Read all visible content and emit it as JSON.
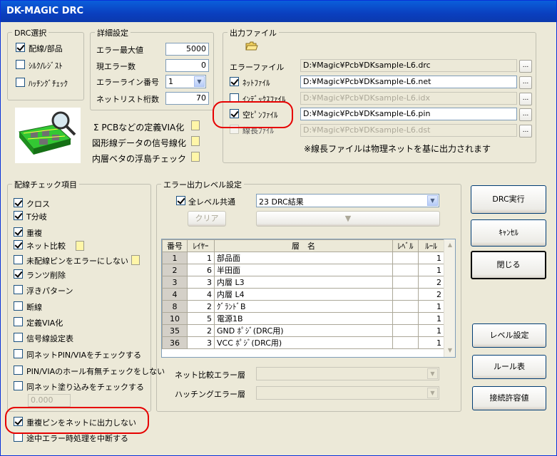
{
  "window": {
    "title": "DK-MAGIC DRC"
  },
  "drc_select": {
    "legend": "DRC選択",
    "items": [
      {
        "label": "配線/部品",
        "checked": true
      },
      {
        "label": "ｼﾙｸ/ﾚｼﾞｽﾄ",
        "checked": false
      },
      {
        "label": "ﾊｯﾁﾝｸﾞﾁｪｯｸ",
        "checked": false
      }
    ]
  },
  "detail": {
    "legend": "詳細設定",
    "max_error_label": "エラー最大値",
    "max_error_value": "5000",
    "current_error_label": "現エラー数",
    "current_error_value": "0",
    "error_line_label": "エラーライン番号",
    "error_line_value": "1",
    "netlist_digits_label": "ネットリスト桁数",
    "netlist_digits_value": "70"
  },
  "output_files": {
    "legend": "出力ファイル",
    "error_file_label": "エラーファイル",
    "error_file_value": "D:¥Magic¥Pcb¥DKsample-L6.drc",
    "net_file_label": "ﾈｯﾄﾌｧｲﾙ",
    "net_file_value": "D:¥Magic¥Pcb¥DKsample-L6.net",
    "index_file_label": "ｲﾝﾃﾞｯｸｽﾌｧｲﾙ",
    "index_file_value": "D:¥Magic¥Pcb¥DKsample-L6.idx",
    "empty_pin_label": "空ﾋﾟﾝﾌｧｲﾙ",
    "empty_pin_value": "D:¥Magic¥Pcb¥DKsample-L6.pin",
    "line_length_label": "線長ﾌｧｲﾙ",
    "line_length_value": "D:¥Magic¥Pcb¥DKsample-L6.dst",
    "note": "※線長ファイルは物理ネットを基に出力されます",
    "browse": "..."
  },
  "options": {
    "via_def": "Σ PCBなどの定義VIA化",
    "shape_signal": "図形線データの信号線化",
    "inner_island": "内層ベタの浮島チェック"
  },
  "wiring_check": {
    "legend": "配線チェック項目",
    "items": [
      {
        "label": "クロス",
        "checked": true
      },
      {
        "label": "T分岐",
        "checked": true
      },
      {
        "label": "重複",
        "checked": true
      },
      {
        "label": "ネット比較",
        "checked": true
      },
      {
        "label": "未配線ピンをエラーにしない",
        "checked": false
      },
      {
        "label": "ランツ削除",
        "checked": true
      },
      {
        "label": "浮きパターン",
        "checked": false
      },
      {
        "label": "断線",
        "checked": false
      },
      {
        "label": "定義VIA化",
        "checked": false
      },
      {
        "label": "信号線設定表",
        "checked": false
      },
      {
        "label": "同ネットPIN/VIAをチェックする",
        "checked": false
      },
      {
        "label": "PIN/VIAのホール有無チェックをしない",
        "checked": false
      },
      {
        "label": "同ネット塗り込みをチェックする",
        "checked": false
      }
    ],
    "fill_value": "0.000",
    "dup_pin": "重複ピンをネットに出力しない",
    "truncated": "途中エラー時処理を中断する"
  },
  "error_level": {
    "legend": "エラー出力レベル設定",
    "all_common_label": "全レベル共通",
    "level_select": "23  DRC結果",
    "clear_label": "クリア",
    "table_headers": [
      "番号",
      "ﾚｲﾔｰ",
      "層　名",
      "ﾚﾍﾞﾙ",
      "ﾙｰﾙ"
    ],
    "rows": [
      [
        "1",
        "1",
        "部品面",
        "",
        "1"
      ],
      [
        "2",
        "6",
        "半田面",
        "",
        "1"
      ],
      [
        "3",
        "3",
        "内層 L3",
        "",
        "2"
      ],
      [
        "4",
        "4",
        "内層 L4",
        "",
        "2"
      ],
      [
        "8",
        "2",
        "ｸﾞﾗﾝﾄﾞB",
        "",
        "1"
      ],
      [
        "10",
        "5",
        "電源1B",
        "",
        "1"
      ],
      [
        "35",
        "2",
        "GND ﾎﾟｼﾞ(DRC用)",
        "",
        "1"
      ],
      [
        "36",
        "3",
        "VCC ﾎﾟｼﾞ(DRC用)",
        "",
        "1"
      ]
    ],
    "net_compare_label": "ネット比較エラー層",
    "hatching_label": "ハッチングエラー層"
  },
  "buttons": {
    "run": "DRC実行",
    "cancel": "ｷｬﾝｾﾙ",
    "close": "閉じる",
    "level_setting": "レベル設定",
    "rule_table": "ルール表",
    "connection": "接続許容値"
  }
}
